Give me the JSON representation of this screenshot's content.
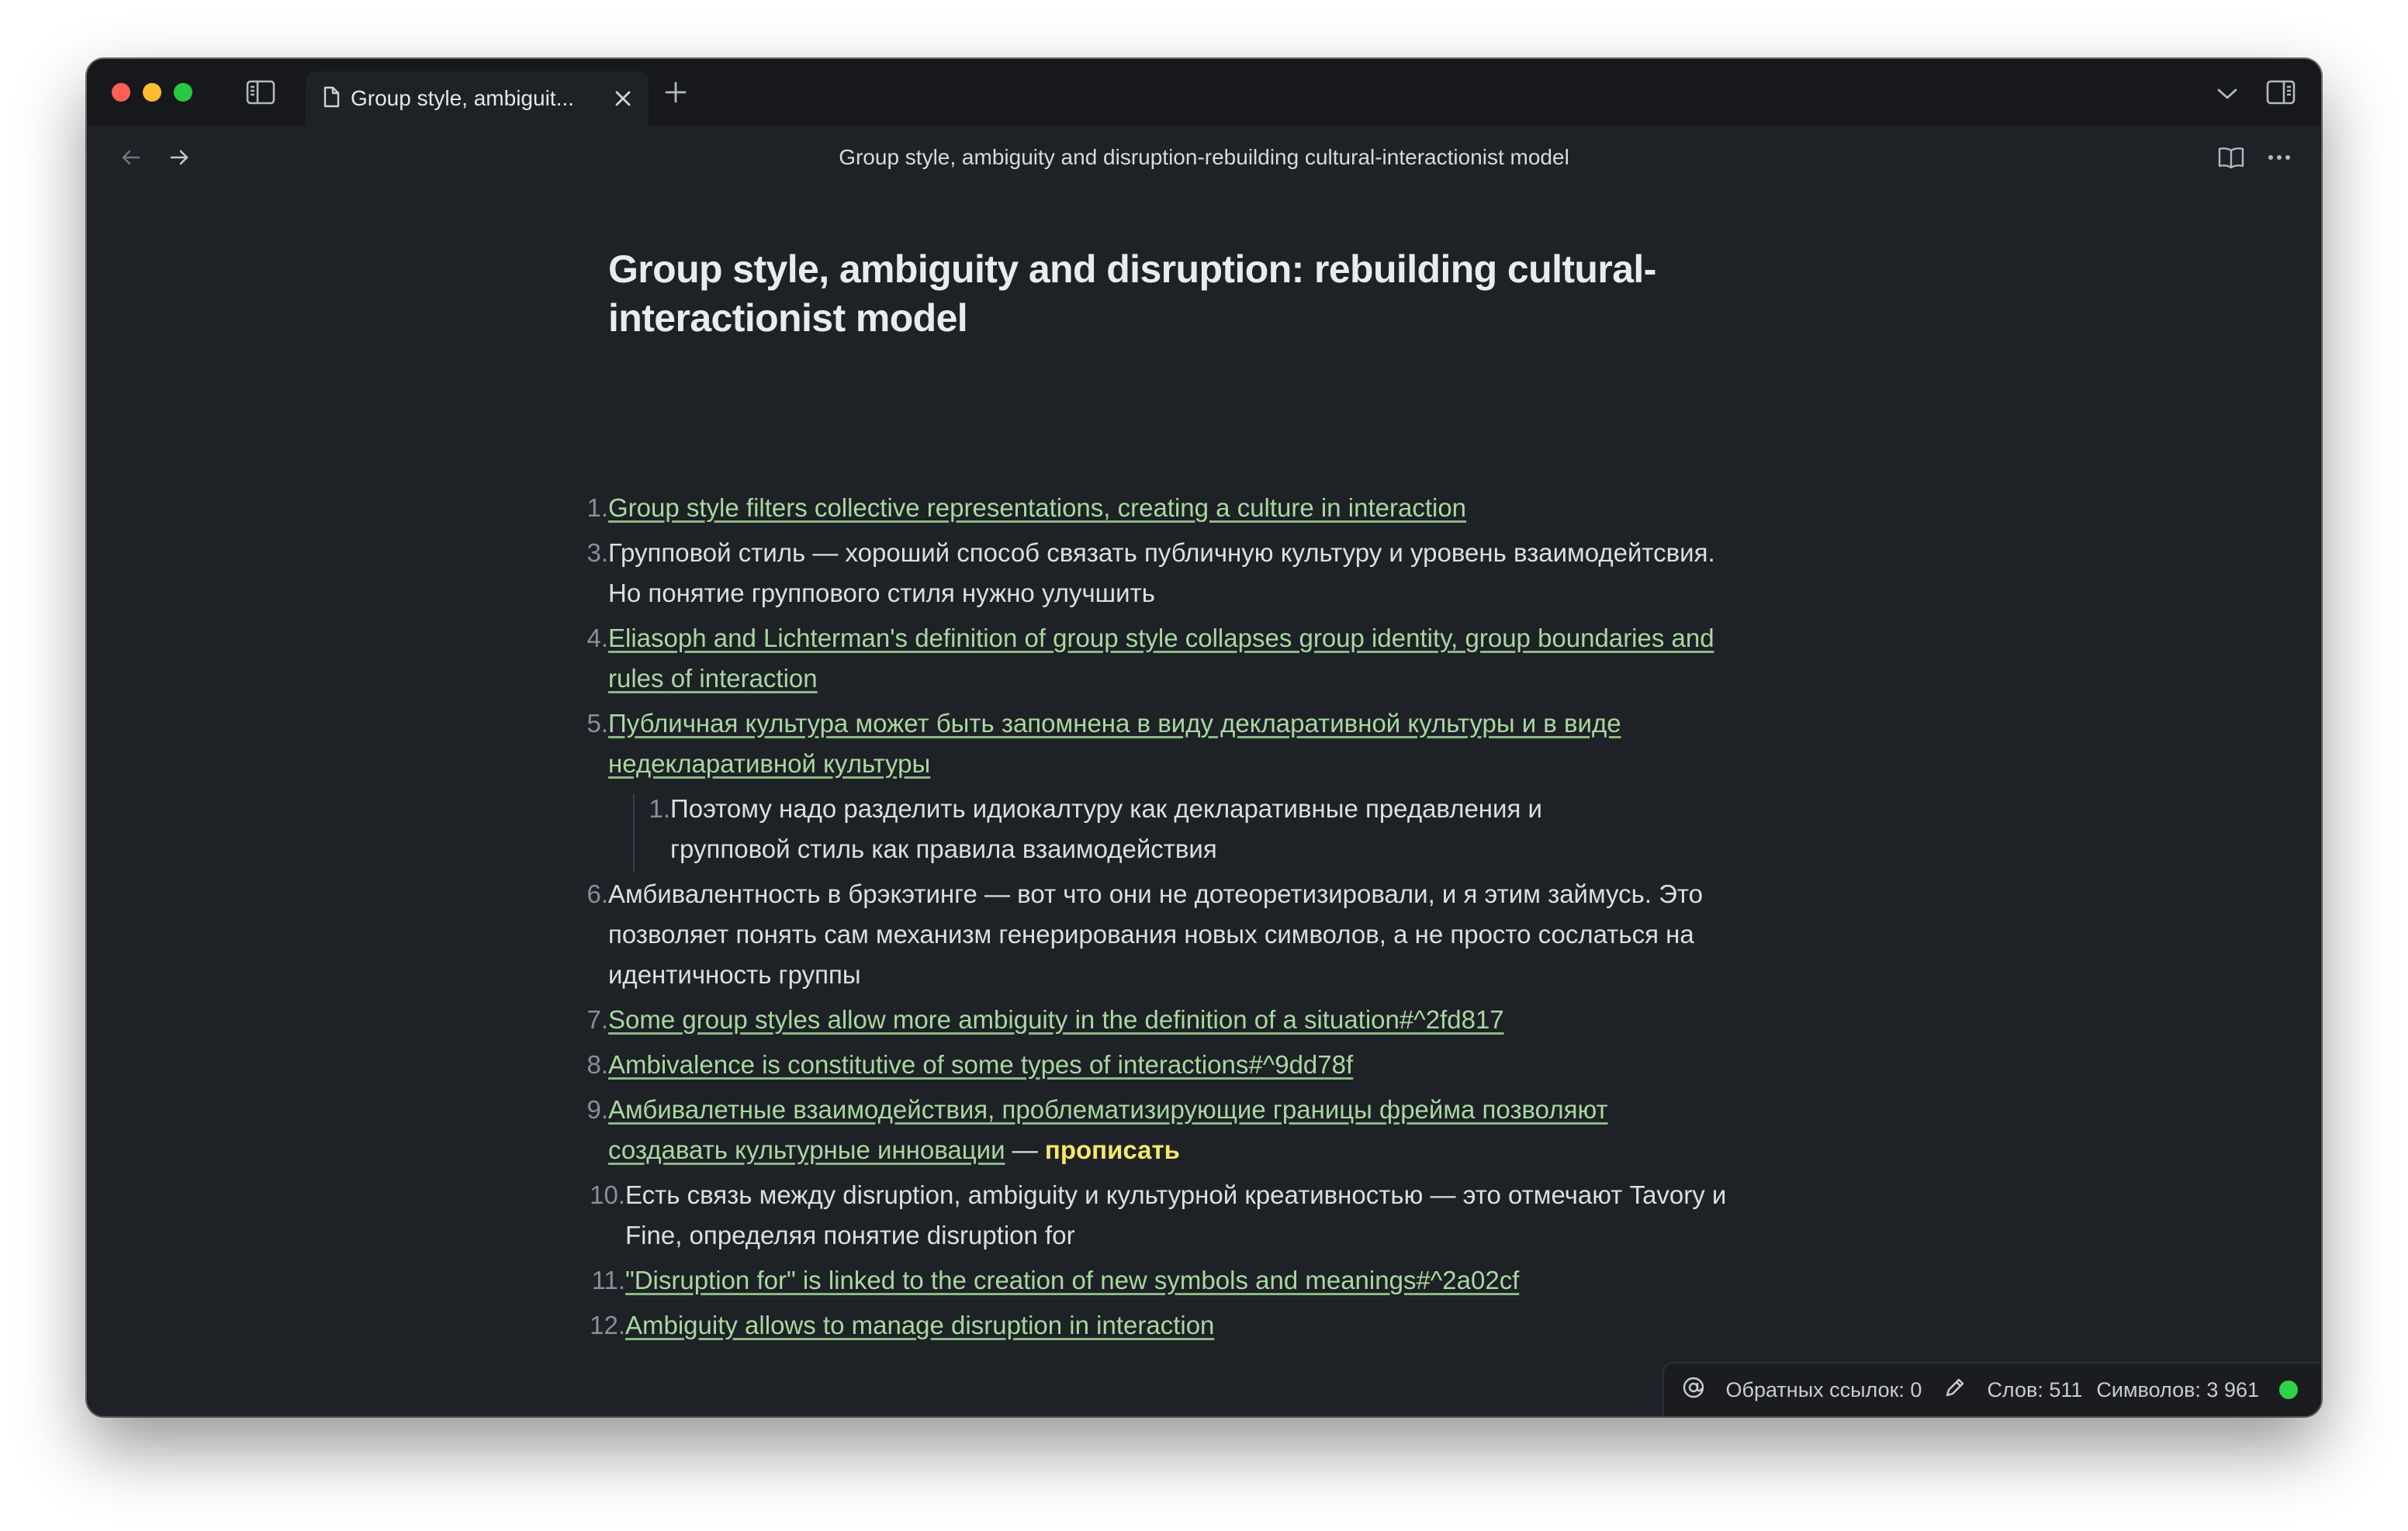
{
  "tab": {
    "title": "Group style, ambiguit..."
  },
  "nav": {
    "title": "Group style, ambiguity and disruption-rebuilding cultural-interactionist model"
  },
  "note": {
    "title": "Group style, ambiguity and disruption: rebuilding cultural-interactionist model",
    "items": [
      {
        "num": "1.",
        "text": "Group style filters collective representations, creating a culture in interaction"
      },
      {
        "num": "3.",
        "text": "Групповой стиль — хороший способ связать публичную культуру и уровень взаимодейтсвия. Но понятие группового стиля нужно улучшить"
      },
      {
        "num": "4.",
        "text": "Eliasoph and Lichterman's definition of group style collapses group identity, group boundaries and rules of interaction"
      },
      {
        "num": "5.",
        "text": "Публичная культура может быть запомнена в виду декларативной культуры и в виде недекларативной культуры"
      },
      {
        "num": "1.",
        "text": "Поэтому надо разделить идиокалтуру как декларативные предавления и групповой стиль как правила взаимодействия"
      },
      {
        "num": "6.",
        "text": "Амбивалентность в брэкэтинге — вот что они не дотеоретизировали, и я этим займусь. Это позволяет понять сам механизм генерирования новых символов, а не просто сослаться на идентичность группы"
      },
      {
        "num": "7.",
        "text": "Some group styles allow more ambiguity in the definition of a situation#^2fd817"
      },
      {
        "num": "8.",
        "text": "Ambivalence is constitutive of some types of interactions#^9dd78f"
      },
      {
        "num": "9.",
        "text": "Амбивалетные взаимодействия, проблематизирующие границы фрейма позволяют создавать культурные инновации",
        "dash": " — ",
        "bold": "прописать"
      },
      {
        "num": "10.",
        "text": "Есть связь между disruption, ambiguity и культурной креативностью — это отмечают Tavory и Fine, определяя понятие disruption for"
      },
      {
        "num": "11.",
        "text": "\"Disruption for\" is linked to the creation of new symbols and meanings#^2a02cf"
      },
      {
        "num": "12.",
        "text": "Ambiguity allows to manage disruption in interaction"
      }
    ]
  },
  "status": {
    "backlinks": "Обратных ссылок: 0",
    "words": "Слов: 511",
    "chars": "Символов: 3 961"
  },
  "colors": {
    "background": "#1e2126",
    "link": "#a8d8a0",
    "highlight": "#f5e86a",
    "sync": "#2fd14a"
  }
}
